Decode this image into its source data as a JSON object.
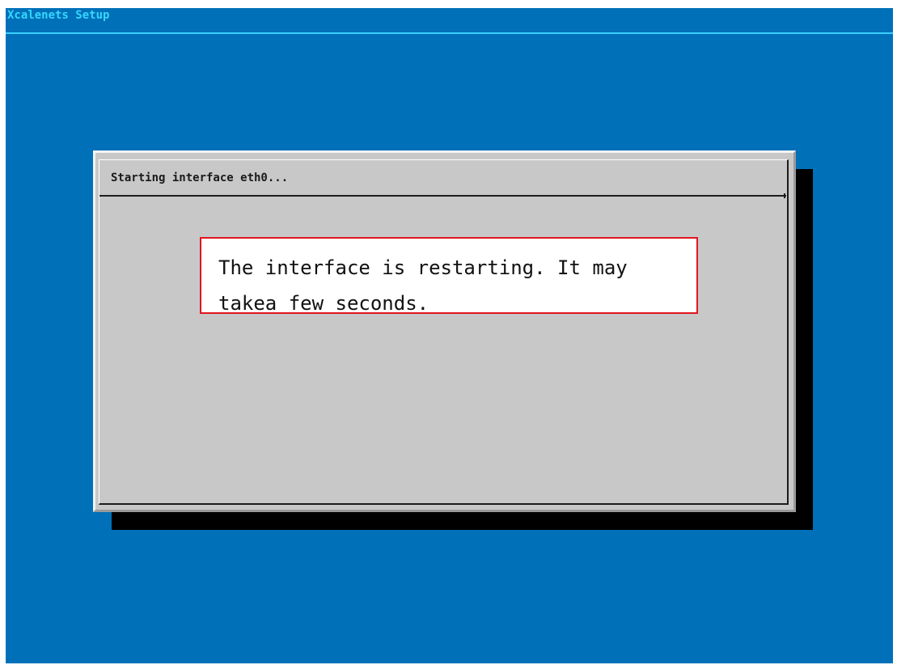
{
  "window": {
    "title": "Xcalenets Setup"
  },
  "dialog": {
    "title": "Starting interface eth0..."
  },
  "annotation": {
    "line1": "The interface is restarting. It may",
    "line2": "takea few seconds."
  },
  "colors": {
    "background": "#0070b8",
    "title_text": "#35d7ff",
    "dialog_face": "#c8c8c8",
    "shadow": "#000000",
    "annotation_border": "#e2141e"
  }
}
